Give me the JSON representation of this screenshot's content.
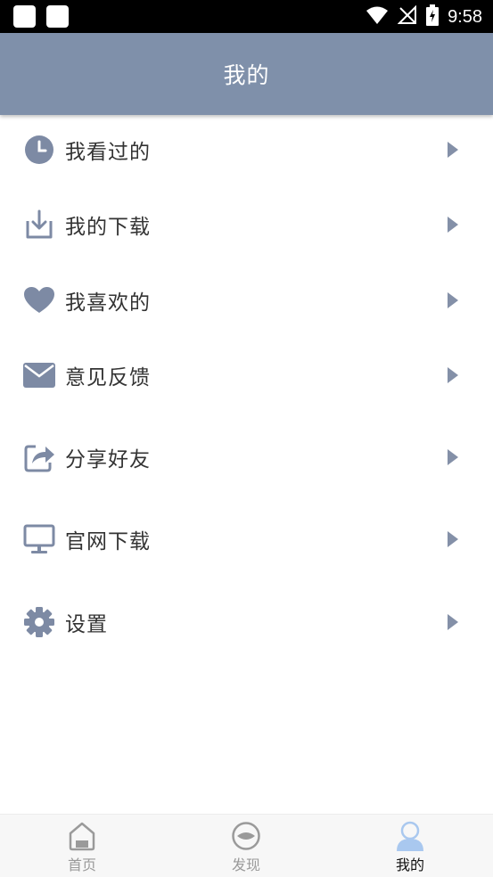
{
  "status_bar": {
    "time": "9:58"
  },
  "header": {
    "title": "我的"
  },
  "menu": {
    "items": [
      {
        "label": "我看过的",
        "icon": "clock-icon"
      },
      {
        "label": "我的下载",
        "icon": "download-icon"
      },
      {
        "label": "我喜欢的",
        "icon": "heart-icon"
      },
      {
        "label": "意见反馈",
        "icon": "envelope-icon"
      },
      {
        "label": "分享好友",
        "icon": "share-icon"
      },
      {
        "label": "官网下载",
        "icon": "monitor-icon"
      },
      {
        "label": "设置",
        "icon": "gear-icon"
      }
    ]
  },
  "tabbar": {
    "tabs": [
      {
        "label": "首页",
        "icon": "home-icon",
        "active": false
      },
      {
        "label": "发现",
        "icon": "discover-icon",
        "active": false
      },
      {
        "label": "我的",
        "icon": "profile-icon",
        "active": true
      }
    ]
  },
  "colors": {
    "accent": "#7f90aa",
    "icon": "#7d8aa4",
    "arrow": "#8490a8",
    "active_tab": "#a9c8ef"
  }
}
